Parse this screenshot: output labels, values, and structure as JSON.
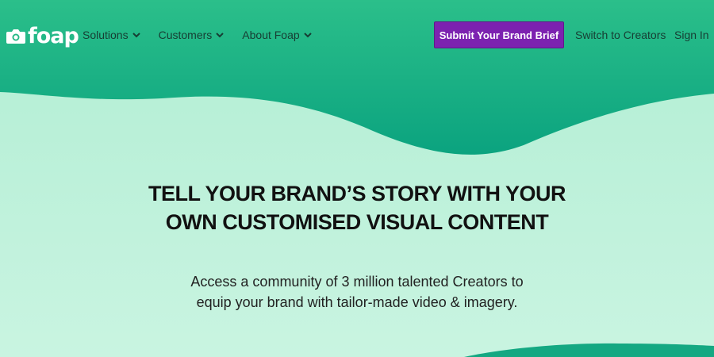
{
  "brand": {
    "logo_text": "foap"
  },
  "nav": {
    "items": [
      {
        "label": "Solutions"
      },
      {
        "label": "Customers"
      },
      {
        "label": "About Foap"
      }
    ]
  },
  "header": {
    "cta_label": "Submit Your Brand Brief",
    "switch_label": "Switch to Creators",
    "signin_label": "Sign In"
  },
  "hero": {
    "title_line1": "TELL YOUR BRAND’S STORY WITH YOUR",
    "title_line2": "OWN CUSTOMISED VISUAL CONTENT",
    "subtitle_line1": "Access a community of 3 million talented Creators to",
    "subtitle_line2": "equip your brand with tailor-made video & imagery."
  },
  "colors": {
    "header_green": "#1fb383",
    "hero_mint": "#b5efd6",
    "cta_purple": "#7c22b0",
    "nav_text": "#173d33"
  }
}
